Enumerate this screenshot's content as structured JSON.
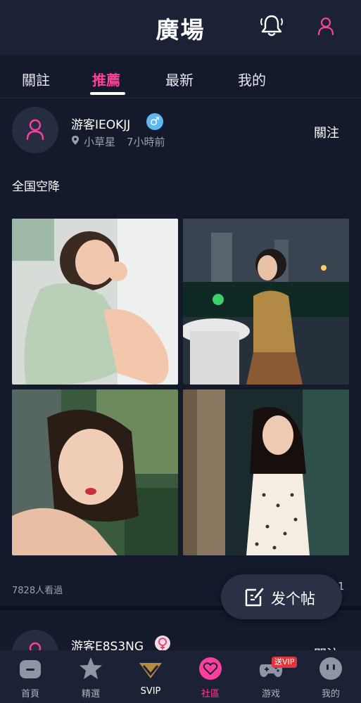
{
  "header": {
    "title": "廣場",
    "bell_icon": "bell-icon",
    "user_icon": "user-icon",
    "accent_color": "#ff3f9e"
  },
  "tabs": [
    {
      "label": "關註",
      "active": false
    },
    {
      "label": "推薦",
      "active": true
    },
    {
      "label": "最新",
      "active": false
    },
    {
      "label": "我的",
      "active": false
    }
  ],
  "post": {
    "username": "游客IEOKJJ",
    "gender_icon": "male-icon",
    "gender_symbol": "♂",
    "location": "小草星",
    "time": "7小時前",
    "follow_label": "關注",
    "text": "全国空降",
    "photos": [
      {
        "icon": "photo-woman-sleeping"
      },
      {
        "icon": "photo-woman-city-night"
      },
      {
        "icon": "photo-woman-selfie"
      },
      {
        "icon": "photo-woman-polka-dress"
      }
    ],
    "views": "7828人看過",
    "comment_count": "1"
  },
  "fab": {
    "label": "发个帖",
    "icon": "edit-icon"
  },
  "post2": {
    "username": "游客E8S3NG",
    "gender_icon": "female-icon",
    "follow_label": "關注"
  },
  "tabbar": [
    {
      "label": "首頁",
      "icon": "home-icon",
      "active": false
    },
    {
      "label": "精選",
      "icon": "star-icon",
      "active": false
    },
    {
      "label": "SVIP",
      "icon": "svip-diamond-icon",
      "active": false
    },
    {
      "label": "社區",
      "icon": "heart-chat-icon",
      "active": true
    },
    {
      "label": "游戏",
      "icon": "gamepad-icon",
      "active": false,
      "badge": "送VIP"
    },
    {
      "label": "我的",
      "icon": "profile-bubble-icon",
      "active": false
    }
  ]
}
